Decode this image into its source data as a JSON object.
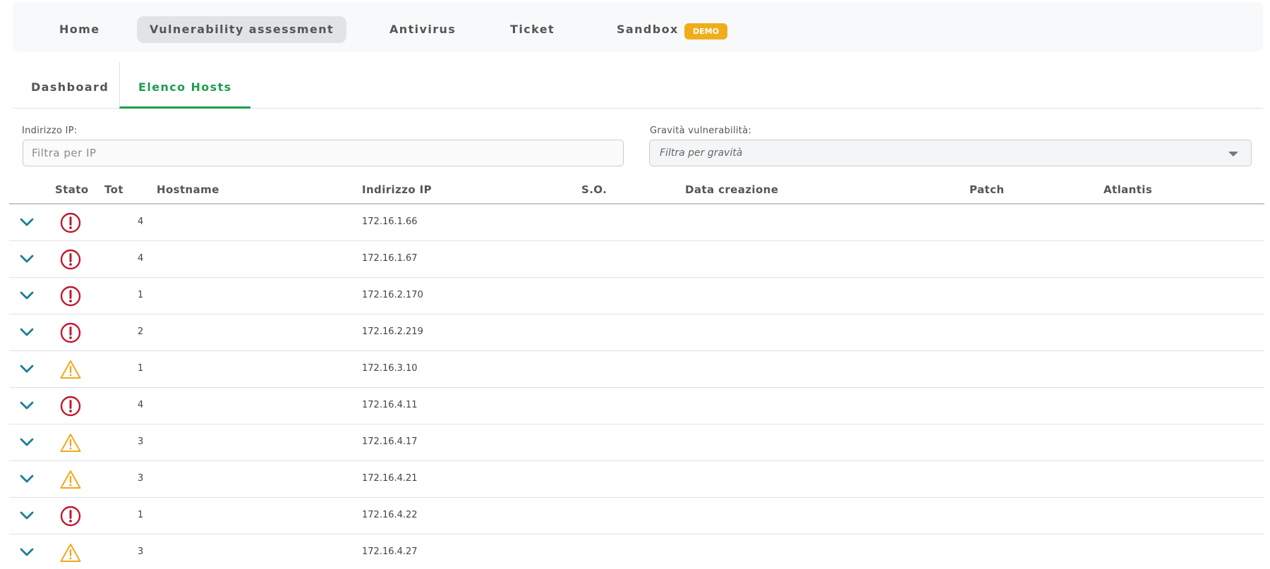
{
  "topnav": {
    "items": [
      {
        "label": "Home",
        "active": false
      },
      {
        "label": "Vulnerability assessment",
        "active": true
      },
      {
        "label": "Antivirus",
        "active": false
      },
      {
        "label": "Ticket",
        "active": false
      },
      {
        "label": "Sandbox",
        "active": false
      }
    ],
    "badge": "DEMO"
  },
  "subtabs": [
    {
      "label": "Dashboard",
      "active": false
    },
    {
      "label": "Elenco Hosts",
      "active": true
    }
  ],
  "filters": {
    "ip_label": "Indirizzo IP:",
    "ip_placeholder": "Filtra per IP",
    "severity_label": "Gravità vulnerabilità:",
    "severity_placeholder": "Filtra per gravità"
  },
  "table": {
    "columns": [
      "Stato",
      "Tot",
      "Hostname",
      "Indirizzo IP",
      "S.O.",
      "Data creazione",
      "Patch",
      "Atlantis"
    ],
    "rows": [
      {
        "status": "critical",
        "tot": "4",
        "hostname": "",
        "ip": "172.16.1.66"
      },
      {
        "status": "critical",
        "tot": "4",
        "hostname": "",
        "ip": "172.16.1.67"
      },
      {
        "status": "critical",
        "tot": "1",
        "hostname": "",
        "ip": "172.16.2.170"
      },
      {
        "status": "critical",
        "tot": "2",
        "hostname": "",
        "ip": "172.16.2.219"
      },
      {
        "status": "warning",
        "tot": "1",
        "hostname": "",
        "ip": "172.16.3.10"
      },
      {
        "status": "critical",
        "tot": "4",
        "hostname": "",
        "ip": "172.16.4.11"
      },
      {
        "status": "warning",
        "tot": "3",
        "hostname": "",
        "ip": "172.16.4.17"
      },
      {
        "status": "warning",
        "tot": "3",
        "hostname": "",
        "ip": "172.16.4.21"
      },
      {
        "status": "critical",
        "tot": "1",
        "hostname": "",
        "ip": "172.16.4.22"
      },
      {
        "status": "warning",
        "tot": "3",
        "hostname": "",
        "ip": "172.16.4.27"
      }
    ]
  },
  "colors": {
    "accent_green": "#1e9e4f",
    "chevron_teal": "#1a7f96",
    "critical_red": "#c0182c",
    "warning_orange": "#f0a81c",
    "badge_orange": "#f0ad1a"
  },
  "icons": {
    "expand": "chevron-down-icon",
    "critical": "exclamation-circle-icon",
    "warning": "warning-triangle-icon",
    "dropdown": "caret-down-icon"
  }
}
